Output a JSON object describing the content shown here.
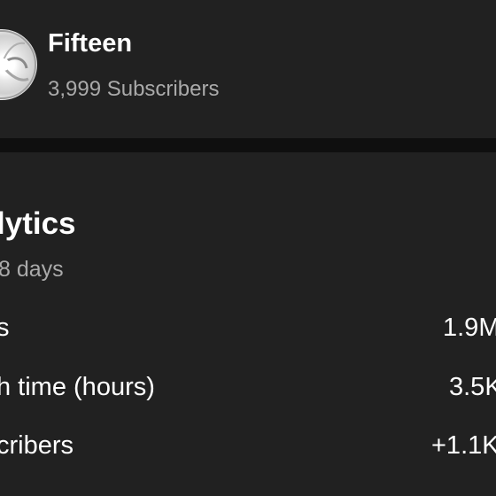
{
  "channel": {
    "name": "Fifteen",
    "subscribers": "3,999 Subscribers"
  },
  "analytics": {
    "title": "lytics",
    "period": "8 days",
    "metrics": [
      {
        "label": "s",
        "value": "1.9M"
      },
      {
        "label": "h time (hours)",
        "value": "3.5K"
      },
      {
        "label": "cribers",
        "value": "+1.1K"
      }
    ]
  },
  "colors": {
    "background": "#212121",
    "divider": "#0f0f0f",
    "primary_text": "#ffffff",
    "secondary_text": "#aaaaaa"
  }
}
